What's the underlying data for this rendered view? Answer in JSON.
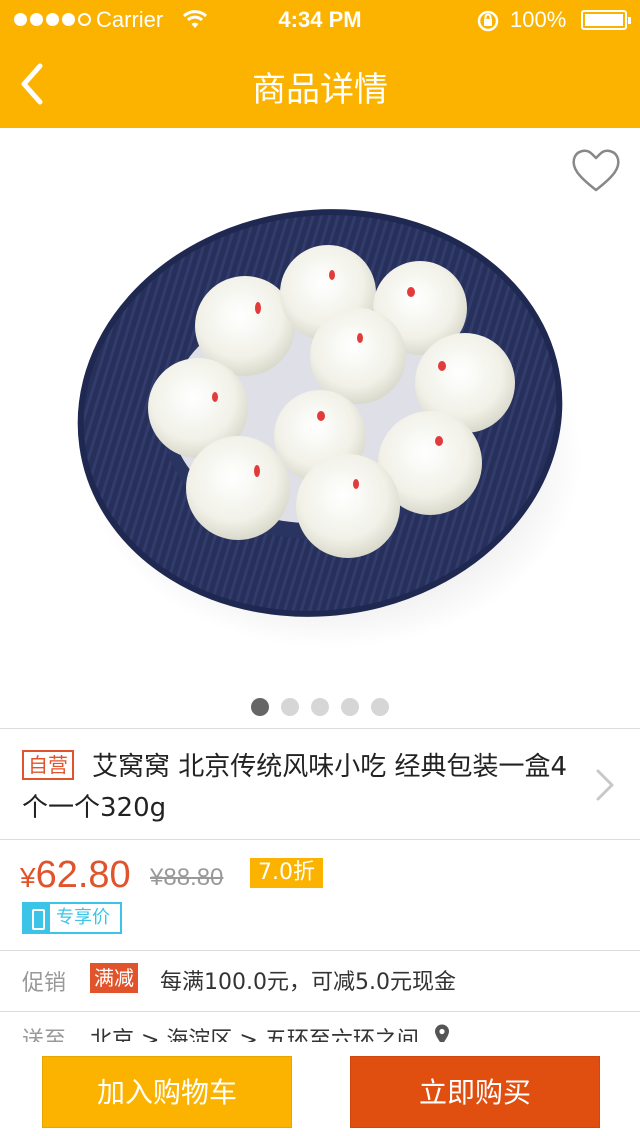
{
  "status_bar": {
    "carrier": "Carrier",
    "time": "4:34 PM",
    "battery": "100%",
    "icons": [
      "signal-dots-icon",
      "wifi-icon",
      "rotation-lock-icon",
      "battery-icon"
    ]
  },
  "nav": {
    "title": "商品详情",
    "back_icon": "chevron-left-icon"
  },
  "gallery": {
    "image_desc_icon": "product-photo",
    "favorite_icon": "heart-outline-icon",
    "page_count": 5,
    "active_page": 1
  },
  "product": {
    "self_tag": "自营",
    "name": "艾窝窝  北京传统风味小吃  经典包装一盒4个一个320g"
  },
  "price": {
    "currency": "¥",
    "current": "62.80",
    "original": "¥88.80",
    "discount": "7.0折",
    "vip_label": "专享价"
  },
  "promotion": {
    "label": "促销",
    "tag": "满减",
    "text": "每满100.0元，可减5.0元现金"
  },
  "shipping": {
    "label": "送至",
    "address": "北京 > 海淀区 > 五环至六环之间"
  },
  "actions": {
    "add_to_cart": "加入购物车",
    "buy_now": "立即购买"
  },
  "colors": {
    "brand_yellow": "#fbb300",
    "accent_red": "#e0532b",
    "buy_button": "#e04e10",
    "vip_blue": "#3cc4e8",
    "plate_navy": "#28325e"
  }
}
